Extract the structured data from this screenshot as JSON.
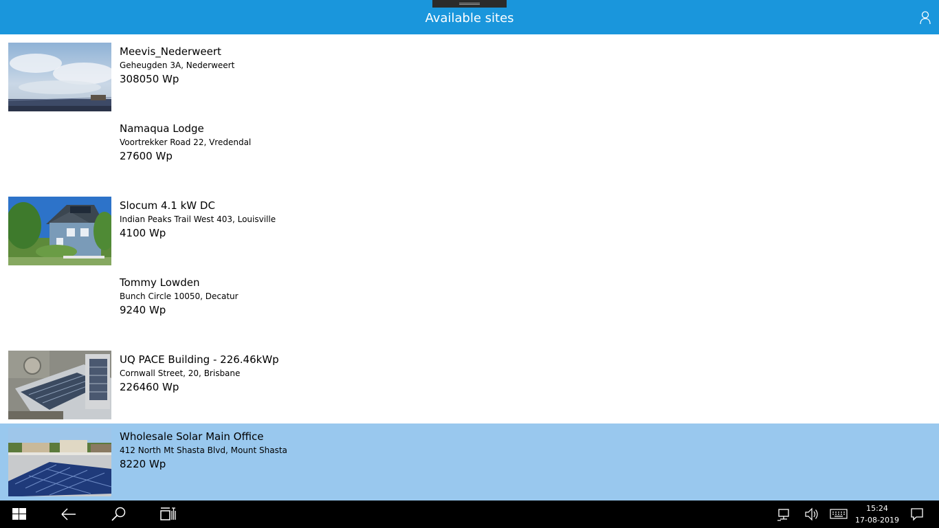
{
  "header": {
    "title": "Available sites",
    "background": "#1a96dc",
    "user_icon": "user-icon"
  },
  "sites": [
    {
      "name": "Meevis_Nederweert",
      "address": "Geheugden 3A,  Nederweert",
      "power": "308050 Wp",
      "has_image": true
    },
    {
      "name": "Namaqua Lodge",
      "address": "Voortrekker Road 22,  Vredendal",
      "power": "27600 Wp",
      "has_image": false
    },
    {
      "name": "Slocum 4.1 kW DC",
      "address": "Indian Peaks Trail West 403,  Louisville",
      "power": "4100 Wp",
      "has_image": true
    },
    {
      "name": "Tommy Lowden",
      "address": "Bunch Circle 10050,  Decatur",
      "power": "9240 Wp",
      "has_image": false
    },
    {
      "name": "UQ PACE Building - 226.46kWp",
      "address": "Cornwall Street, 20,  Brisbane",
      "power": "226460 Wp",
      "has_image": true
    },
    {
      "name": "Wholesale Solar Main Office",
      "address": "412 North Mt Shasta Blvd,  Mount Shasta",
      "power": "8220 Wp",
      "has_image": true,
      "selected": true
    }
  ],
  "selection_color": "#99c8ee",
  "taskbar": {
    "icons": [
      "windows-start-icon",
      "back-arrow-icon",
      "search-icon",
      "task-view-icon",
      "network-icon",
      "volume-icon",
      "keyboard-icon",
      "action-center-icon"
    ],
    "time": "15:24",
    "date": "17-08-2019"
  }
}
